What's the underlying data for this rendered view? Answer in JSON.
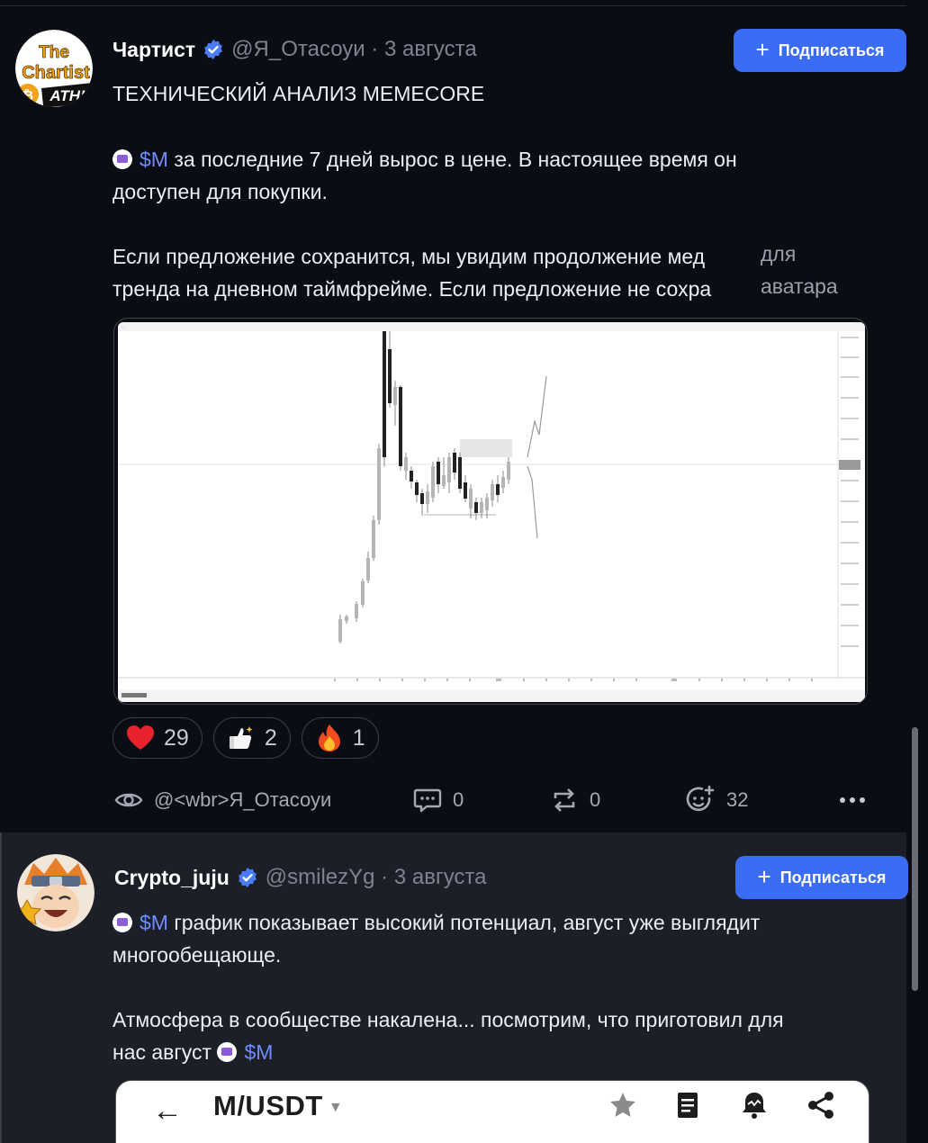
{
  "post1": {
    "author": "Чартист",
    "handle_date": "@Я_Отасоуи · 3 августа",
    "avatar_text": [
      "The",
      "Chartist",
      "ATH!"
    ],
    "follow_label": "Подписаться",
    "title": "ТЕХНИЧЕСКИЙ АНАЛИЗ MEMECORE",
    "ticker": "$M",
    "para1_line1_rest": " за последние 7 дней вырос в цене. В настоящее время он",
    "para1_line2": "доступен для покупки.",
    "para2_line1": "Если предложение сохранится, мы увидим продолжение мед",
    "para2_line2": "тренда на дневном таймфрейме. Если предложение не сохра",
    "overlay_line1": "для",
    "overlay_line2": "аватара",
    "reactions": [
      {
        "emoji": "heart-icon",
        "count": "29"
      },
      {
        "emoji": "thumbs-up-icon",
        "count": "2"
      },
      {
        "emoji": "fire-icon",
        "count": "1"
      }
    ],
    "actions": {
      "views_label": "@<wbr>Я_Отасоуи",
      "comments": "0",
      "reposts": "0",
      "reactions": "32"
    }
  },
  "post2": {
    "author": "Crypto_juju",
    "handle_date": "@smilezYg · 3 августа",
    "follow_label": "Подписаться",
    "ticker": "$M",
    "para1_line1_rest": " график показывает высокий потенциал, август уже выглядит",
    "para1_line2": "многообещающе.",
    "para2_line1": "Атмосфера в сообществе накалена... посмотрим, что приготовил для",
    "para2_line2_prefix": "нас август ",
    "screenshot_title": "M/USDT",
    "screenshot_back": "←"
  },
  "colors": {
    "accent": "#3a6cf4",
    "ticker": "#6f8dff",
    "background": "#0b0d14",
    "reply_background": "#1c1e28"
  }
}
